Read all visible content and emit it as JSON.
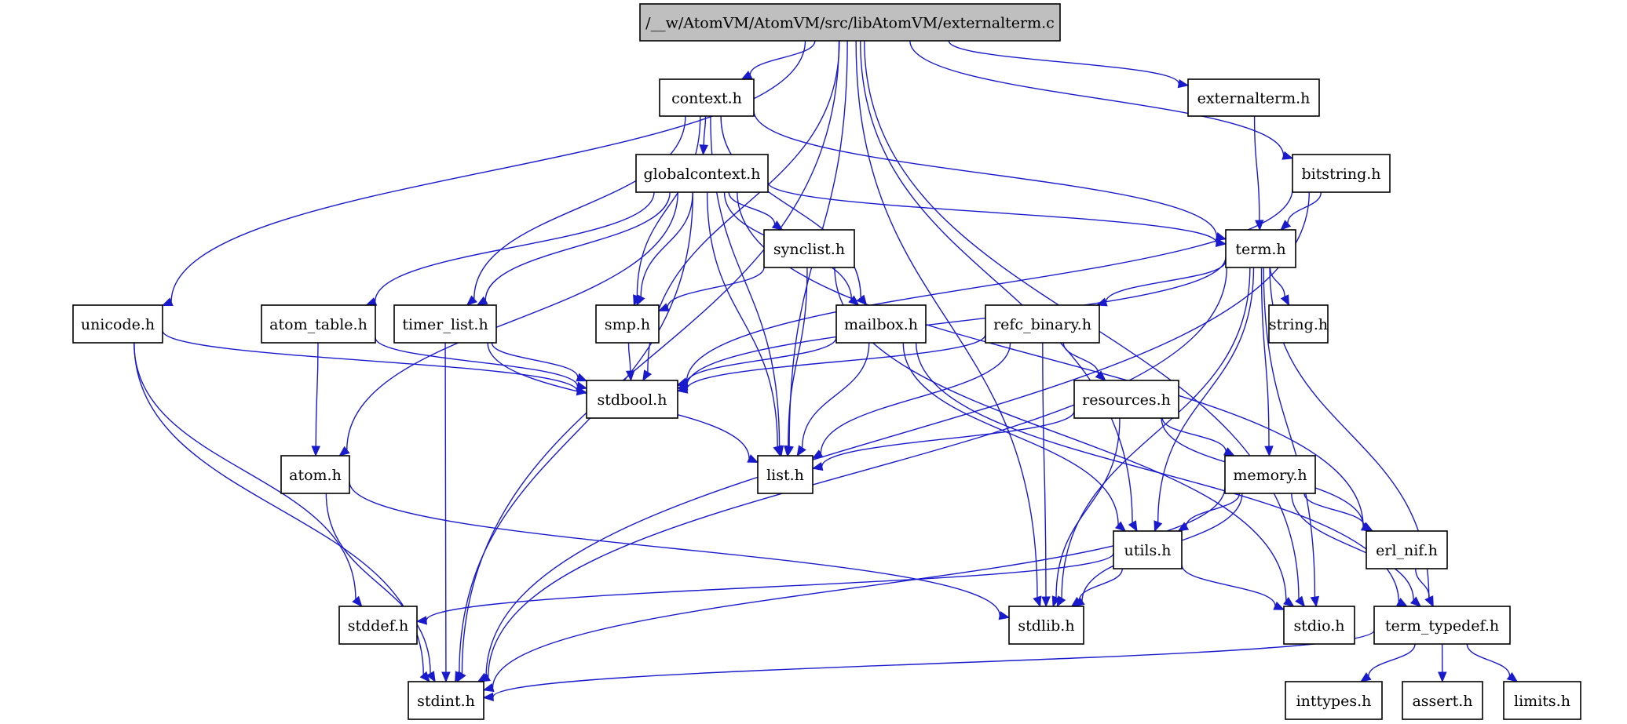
{
  "diagram": {
    "type": "include-dependency-graph",
    "colors": {
      "edge": "#1a1acd",
      "root_fill": "#bfbfbf",
      "node_fill": "#ffffff",
      "node_border": "#000000"
    },
    "root": "externalterm_c",
    "nodes": [
      {
        "id": "externalterm_c",
        "label": "/__w/AtomVM/AtomVM/src/libAtomVM/externalterm.c",
        "root": true
      },
      {
        "id": "context_h",
        "label": "context.h"
      },
      {
        "id": "externalterm_h",
        "label": "externalterm.h"
      },
      {
        "id": "globalcontext_h",
        "label": "globalcontext.h"
      },
      {
        "id": "bitstring_h",
        "label": "bitstring.h"
      },
      {
        "id": "synclist_h",
        "label": "synclist.h"
      },
      {
        "id": "term_h",
        "label": "term.h"
      },
      {
        "id": "unicode_h",
        "label": "unicode.h"
      },
      {
        "id": "atom_table_h",
        "label": "atom_table.h"
      },
      {
        "id": "timer_list_h",
        "label": "timer_list.h"
      },
      {
        "id": "smp_h",
        "label": "smp.h"
      },
      {
        "id": "mailbox_h",
        "label": "mailbox.h"
      },
      {
        "id": "refc_binary_h",
        "label": "refc_binary.h"
      },
      {
        "id": "string_h",
        "label": "string.h"
      },
      {
        "id": "stdbool_h",
        "label": "stdbool.h"
      },
      {
        "id": "resources_h",
        "label": "resources.h"
      },
      {
        "id": "atom_h",
        "label": "atom.h"
      },
      {
        "id": "list_h",
        "label": "list.h"
      },
      {
        "id": "memory_h",
        "label": "memory.h"
      },
      {
        "id": "utils_h",
        "label": "utils.h"
      },
      {
        "id": "erl_nif_h",
        "label": "erl_nif.h"
      },
      {
        "id": "stddef_h",
        "label": "stddef.h"
      },
      {
        "id": "stdlib_h",
        "label": "stdlib.h"
      },
      {
        "id": "stdio_h",
        "label": "stdio.h"
      },
      {
        "id": "term_typedef_h",
        "label": "term_typedef.h"
      },
      {
        "id": "stdint_h",
        "label": "stdint.h"
      },
      {
        "id": "inttypes_h",
        "label": "inttypes.h"
      },
      {
        "id": "assert_h",
        "label": "assert.h"
      },
      {
        "id": "limits_h",
        "label": "limits.h"
      }
    ],
    "edges": [
      [
        "externalterm_c",
        "context_h"
      ],
      [
        "externalterm_c",
        "externalterm_h"
      ],
      [
        "externalterm_c",
        "bitstring_h"
      ],
      [
        "externalterm_c",
        "unicode_h"
      ],
      [
        "externalterm_c",
        "stdbool_h"
      ],
      [
        "externalterm_c",
        "list_h"
      ],
      [
        "externalterm_c",
        "utils_h"
      ],
      [
        "externalterm_c",
        "stdlib_h"
      ],
      [
        "externalterm_c",
        "stdio_h"
      ],
      [
        "externalterm_c",
        "stdint_h"
      ],
      [
        "context_h",
        "globalcontext_h"
      ],
      [
        "context_h",
        "term_h"
      ],
      [
        "context_h",
        "timer_list_h"
      ],
      [
        "context_h",
        "smp_h"
      ],
      [
        "context_h",
        "mailbox_h"
      ],
      [
        "context_h",
        "list_h"
      ],
      [
        "externalterm_h",
        "term_h"
      ],
      [
        "globalcontext_h",
        "synclist_h"
      ],
      [
        "globalcontext_h",
        "term_h"
      ],
      [
        "globalcontext_h",
        "atom_table_h"
      ],
      [
        "globalcontext_h",
        "timer_list_h"
      ],
      [
        "globalcontext_h",
        "smp_h"
      ],
      [
        "globalcontext_h",
        "mailbox_h"
      ],
      [
        "globalcontext_h",
        "atom_h"
      ],
      [
        "globalcontext_h",
        "list_h"
      ],
      [
        "globalcontext_h",
        "erl_nif_h"
      ],
      [
        "globalcontext_h",
        "stdint_h"
      ],
      [
        "bitstring_h",
        "term_h"
      ],
      [
        "bitstring_h",
        "stdbool_h"
      ],
      [
        "bitstring_h",
        "stdint_h"
      ],
      [
        "synclist_h",
        "smp_h"
      ],
      [
        "synclist_h",
        "list_h"
      ],
      [
        "synclist_h",
        "stdio_h"
      ],
      [
        "term_h",
        "refc_binary_h"
      ],
      [
        "term_h",
        "string_h"
      ],
      [
        "term_h",
        "stdbool_h"
      ],
      [
        "term_h",
        "memory_h"
      ],
      [
        "term_h",
        "utils_h"
      ],
      [
        "term_h",
        "stdlib_h"
      ],
      [
        "term_h",
        "stdio_h"
      ],
      [
        "term_h",
        "term_typedef_h"
      ],
      [
        "term_h",
        "stdint_h"
      ],
      [
        "unicode_h",
        "stdbool_h"
      ],
      [
        "unicode_h",
        "stddef_h"
      ],
      [
        "unicode_h",
        "stdint_h"
      ],
      [
        "atom_table_h",
        "stdbool_h"
      ],
      [
        "atom_table_h",
        "atom_h"
      ],
      [
        "timer_list_h",
        "stdbool_h"
      ],
      [
        "timer_list_h",
        "list_h"
      ],
      [
        "timer_list_h",
        "stdint_h"
      ],
      [
        "smp_h",
        "stdbool_h"
      ],
      [
        "mailbox_h",
        "stdbool_h"
      ],
      [
        "mailbox_h",
        "list_h"
      ],
      [
        "mailbox_h",
        "utils_h"
      ],
      [
        "mailbox_h",
        "term_typedef_h"
      ],
      [
        "refc_binary_h",
        "resources_h"
      ],
      [
        "refc_binary_h",
        "stdbool_h"
      ],
      [
        "refc_binary_h",
        "list_h"
      ],
      [
        "refc_binary_h",
        "stdlib_h"
      ],
      [
        "resources_h",
        "memory_h"
      ],
      [
        "resources_h",
        "list_h"
      ],
      [
        "resources_h",
        "erl_nif_h"
      ],
      [
        "resources_h",
        "stdlib_h"
      ],
      [
        "atom_h",
        "stdlib_h"
      ],
      [
        "atom_h",
        "stdint_h"
      ],
      [
        "memory_h",
        "utils_h"
      ],
      [
        "memory_h",
        "erl_nif_h"
      ],
      [
        "memory_h",
        "term_typedef_h"
      ],
      [
        "memory_h",
        "stdlib_h"
      ],
      [
        "memory_h",
        "stdint_h"
      ],
      [
        "utils_h",
        "stddef_h"
      ],
      [
        "utils_h",
        "stdlib_h"
      ],
      [
        "utils_h",
        "stdio_h"
      ],
      [
        "erl_nif_h",
        "term_typedef_h"
      ],
      [
        "term_typedef_h",
        "inttypes_h"
      ],
      [
        "term_typedef_h",
        "assert_h"
      ],
      [
        "term_typedef_h",
        "limits_h"
      ],
      [
        "term_typedef_h",
        "stdint_h"
      ]
    ]
  }
}
